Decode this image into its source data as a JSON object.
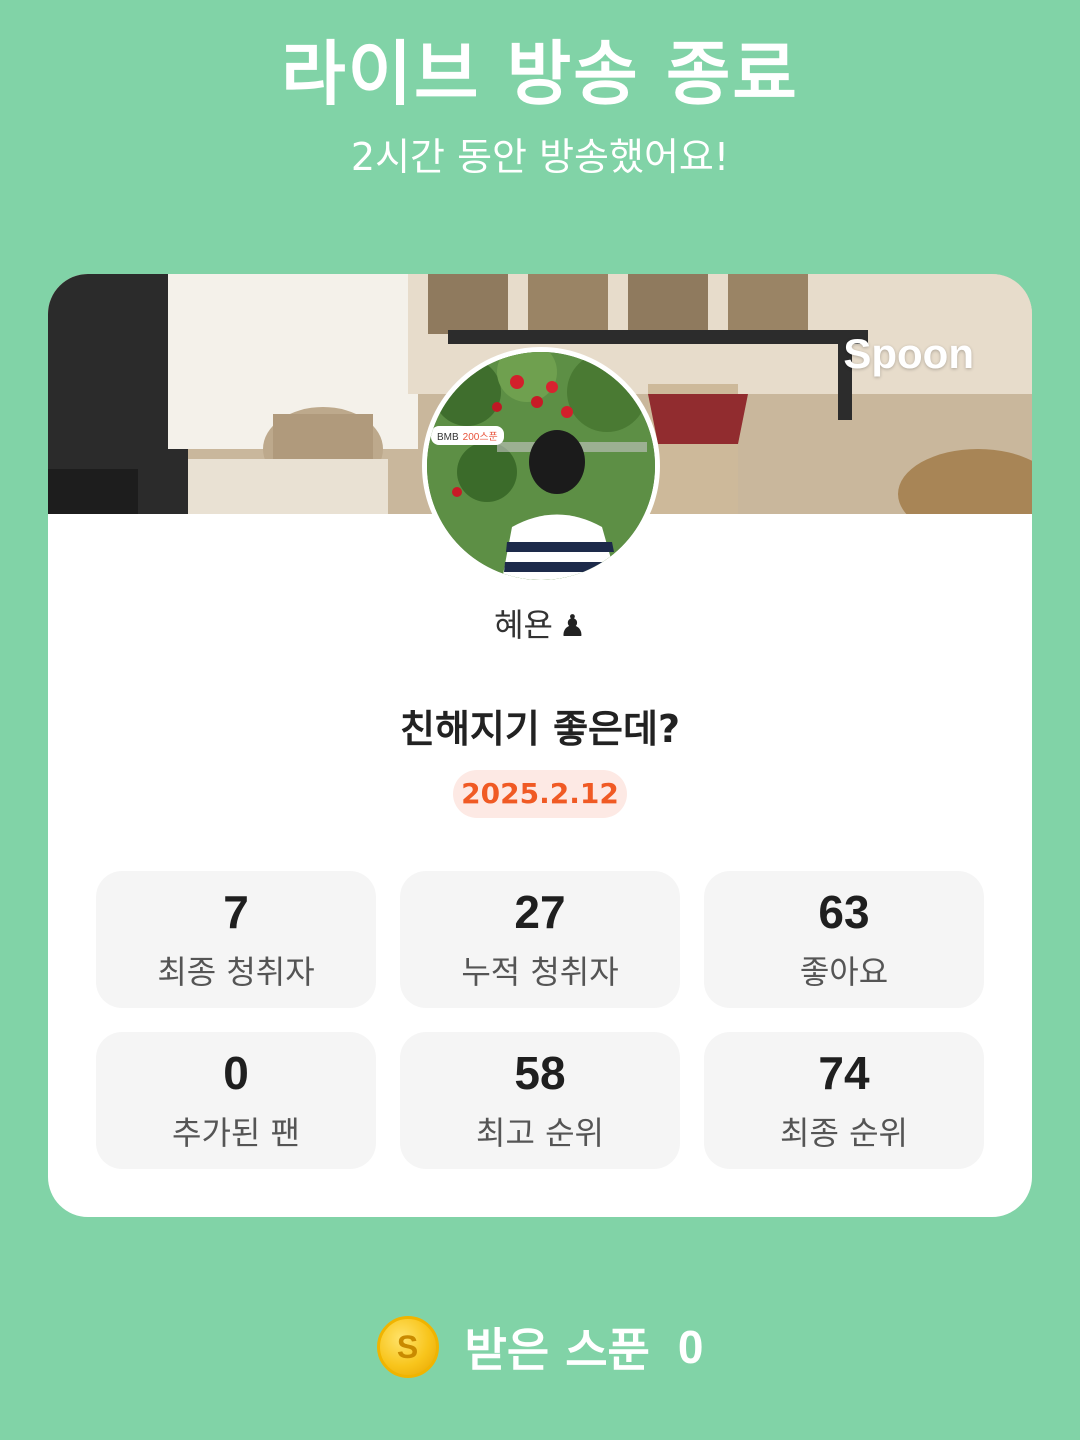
{
  "header": {
    "title": "라이브 방송 종료",
    "subtitle": "2시간 동안 방송했어요!"
  },
  "card": {
    "banner_brand": "Spoon",
    "avatar_badge": {
      "name": "BMB",
      "spoons": "200스푼"
    },
    "nickname": "혜욘",
    "nickname_icon": "pawn-icon",
    "nickname_icon_glyph": "♟",
    "live_title": "친해지기 좋은데?",
    "date": "2025.2.12"
  },
  "stats": [
    {
      "value": "7",
      "label": "최종 청취자"
    },
    {
      "value": "27",
      "label": "누적 청취자"
    },
    {
      "value": "63",
      "label": "좋아요"
    },
    {
      "value": "0",
      "label": "추가된 팬"
    },
    {
      "value": "58",
      "label": "최고 순위"
    },
    {
      "value": "74",
      "label": "최종 순위"
    }
  ],
  "footer": {
    "coin_icon": "spoon-coin-icon",
    "coin_letter": "S",
    "spoons_label": "받은 스푼",
    "spoons_value": "0"
  },
  "colors": {
    "background": "#81d3a7",
    "date_text": "#f05a24",
    "date_pill": "#fde9e4",
    "stat_card": "#f5f5f5"
  }
}
